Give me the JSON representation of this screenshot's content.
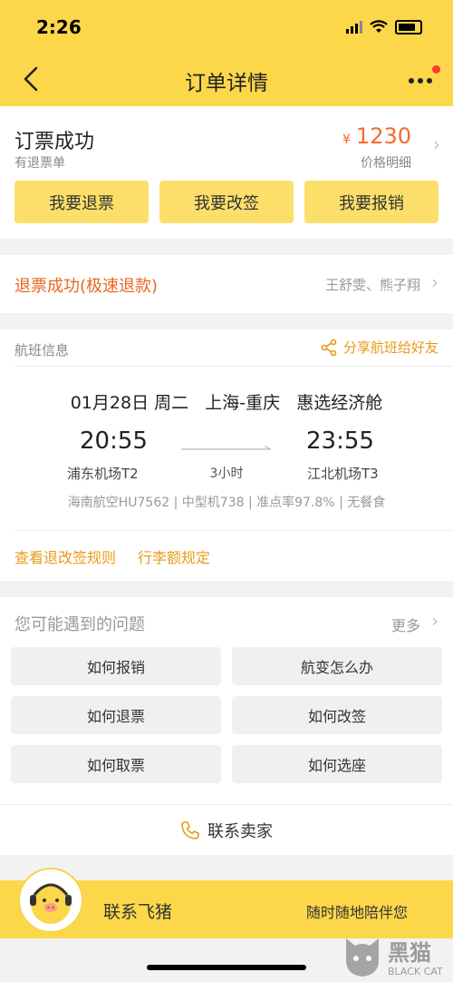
{
  "status_bar": {
    "time": "2:26"
  },
  "header": {
    "title": "订单详情"
  },
  "order_status": {
    "title": "订票成功",
    "subtitle": "有退票单",
    "currency": "¥",
    "price": "1230",
    "price_detail": "价格明细",
    "buttons": [
      "我要退票",
      "我要改签",
      "我要报销"
    ]
  },
  "refund": {
    "status": "退票成功(极速退款)",
    "passengers": "王舒雯、熊子翔"
  },
  "flight": {
    "section_title": "航班信息",
    "share_label": "分享航班给好友",
    "date": "01月28日",
    "weekday": "周二",
    "route": "上海-重庆",
    "cabin": "惠选经济舱",
    "dep_time": "20:55",
    "arr_time": "23:55",
    "dep_airport": "浦东机场T2",
    "arr_airport": "江北机场T3",
    "duration": "3小时",
    "airline": "海南航空HU7562",
    "aircraft": "中型机738",
    "on_time": "准点率97.8%",
    "meal": "无餐食",
    "links": [
      "查看退改签规则",
      "行李额规定"
    ]
  },
  "faq": {
    "title": "您可能遇到的问题",
    "more": "更多",
    "items": [
      "如何报销",
      "航变怎么办",
      "如何退票",
      "如何改签",
      "如何取票",
      "如何选座"
    ],
    "contact_seller": "联系卖家"
  },
  "bottom_bar": {
    "title": "联系飞猪",
    "subtitle": "随时随地陪伴您"
  },
  "watermark": {
    "cn": "黑猫",
    "en": "BLACK CAT"
  }
}
